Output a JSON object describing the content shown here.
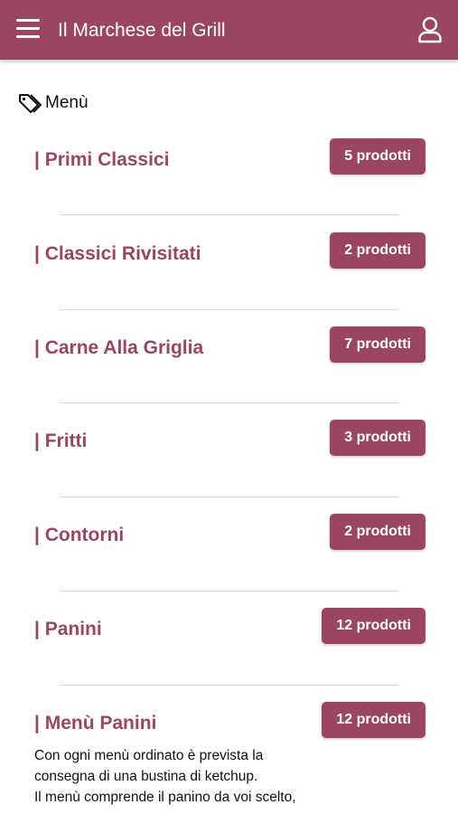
{
  "header": {
    "title": "Il Marchese del Grill",
    "menu_icon": "hamburger-icon",
    "user_icon": "user-icon"
  },
  "section": {
    "label": "Menù",
    "icon": "tag-icon"
  },
  "categories": [
    {
      "name": "| Primi Classici",
      "count": "5 prodotti"
    },
    {
      "name": "| Classici Rivisitati",
      "count": "2 prodotti"
    },
    {
      "name": "| Carne Alla Griglia",
      "count": "7 prodotti"
    },
    {
      "name": "| Fritti",
      "count": "3 prodotti"
    },
    {
      "name": "| Contorni",
      "count": "2 prodotti"
    },
    {
      "name": "| Panini",
      "count": "12 prodotti"
    },
    {
      "name": "| Menù Panini",
      "count": "12 prodotti"
    }
  ],
  "menu_panini_description": [
    "Con ogni menù ordinato è prevista la",
    "consegna di una bustina di ketchup.",
    "Il menù comprende il panino da voi scelto,"
  ],
  "colors": {
    "accent": "#9b4660",
    "divider": "#ecd6dc"
  }
}
